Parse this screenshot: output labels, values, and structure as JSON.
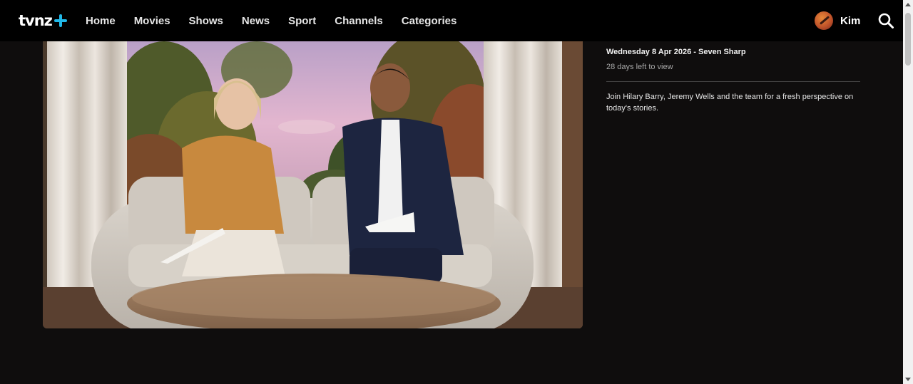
{
  "header": {
    "logo_text": "tvnz",
    "nav": [
      {
        "label": "Home"
      },
      {
        "label": "Movies"
      },
      {
        "label": "Shows"
      },
      {
        "label": "News"
      },
      {
        "label": "Sport"
      },
      {
        "label": "Channels"
      },
      {
        "label": "Categories"
      }
    ],
    "profile_name": "Kim"
  },
  "episode": {
    "title": "Wednesday 8 Apr 2026 - Seven Sharp",
    "remaining": "28 days left to view",
    "description": "Join Hilary Barry, Jeremy Wells and the team for a fresh perspective on today's stories."
  },
  "colors": {
    "header_bg": "#000000",
    "page_bg": "#0f0d0d",
    "accent_plus": "#21b8e8"
  },
  "icons": {
    "logo": "tvnz-plus-logo",
    "search": "search-icon",
    "avatar": "profile-avatar"
  }
}
